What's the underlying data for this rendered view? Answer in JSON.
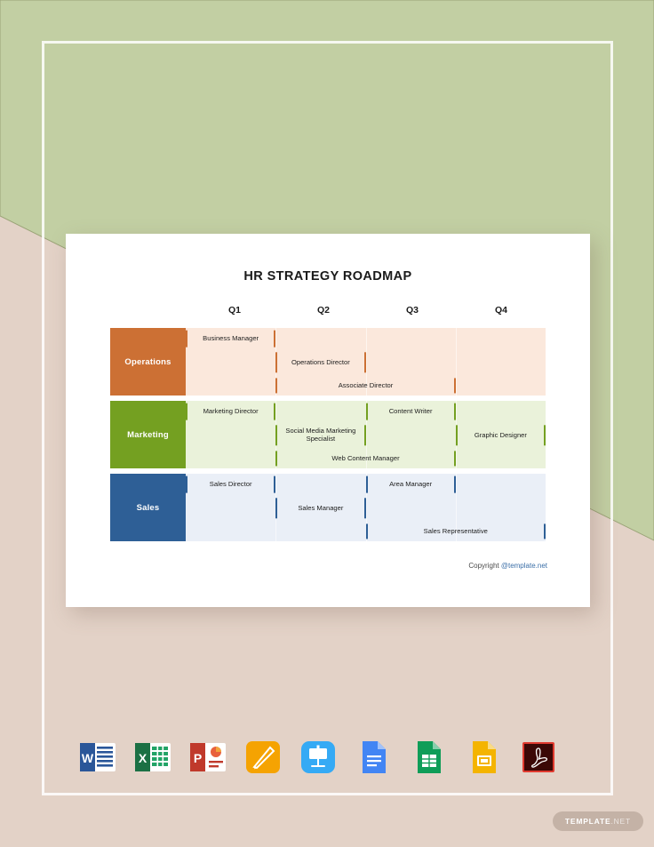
{
  "theme": {
    "background_beige": "#e3d2c7",
    "background_green": "#c2cfa3",
    "card_white": "#ffffff",
    "operations_color": "#cc7034",
    "marketing_color": "#74a021",
    "sales_color": "#2e5f96",
    "operations_tint": "#fbe8dc",
    "marketing_tint": "#eaf2da",
    "sales_tint": "#eaeff7",
    "link_blue": "#3b6fa8"
  },
  "document": {
    "title": "HR STRATEGY ROADMAP",
    "copyright_prefix": "Copyright ",
    "copyright_link": "@template.net"
  },
  "chart_data": {
    "type": "bar",
    "title": "HR STRATEGY ROADMAP",
    "xlabel": "",
    "ylabel": "",
    "categories": [
      "Q1",
      "Q2",
      "Q3",
      "Q4"
    ],
    "quarter_positions_pct": [
      12.5,
      37.5,
      62.5,
      87.5
    ],
    "series": [
      {
        "name": "Operations",
        "color": "#cc7034",
        "tint": "#fbe8dc",
        "tasks": [
          {
            "label": "Business Manager",
            "start_pct": 0,
            "end_pct": 25,
            "lane": 0
          },
          {
            "label": "Operations Director",
            "start_pct": 25,
            "end_pct": 50,
            "lane": 1
          },
          {
            "label": "Associate Director",
            "start_pct": 25,
            "end_pct": 75,
            "lane": 2
          }
        ]
      },
      {
        "name": "Marketing",
        "color": "#74a021",
        "tint": "#eaf2da",
        "tasks": [
          {
            "label": "Marketing Director",
            "start_pct": 0,
            "end_pct": 25,
            "lane": 0
          },
          {
            "label": "Content Writer",
            "start_pct": 50,
            "end_pct": 75,
            "lane": 0
          },
          {
            "label": "Graphic Designer",
            "start_pct": 75,
            "end_pct": 100,
            "lane": 1
          },
          {
            "label": "Social Media Marketing Specialist",
            "start_pct": 25,
            "end_pct": 50,
            "lane": 1
          },
          {
            "label": "Web Content Manager",
            "start_pct": 25,
            "end_pct": 75,
            "lane": 2
          }
        ]
      },
      {
        "name": "Sales",
        "color": "#2e5f96",
        "tint": "#eaeff7",
        "tasks": [
          {
            "label": "Sales Director",
            "start_pct": 0,
            "end_pct": 25,
            "lane": 0
          },
          {
            "label": "Area Manager",
            "start_pct": 50,
            "end_pct": 75,
            "lane": 0
          },
          {
            "label": "Sales Manager",
            "start_pct": 25,
            "end_pct": 50,
            "lane": 1
          },
          {
            "label": "Sales Representative",
            "start_pct": 50,
            "end_pct": 100,
            "lane": 2
          }
        ]
      }
    ]
  },
  "file_formats": [
    {
      "name": "word-icon",
      "label": "Word"
    },
    {
      "name": "excel-icon",
      "label": "Excel"
    },
    {
      "name": "powerpoint-icon",
      "label": "PowerPoint"
    },
    {
      "name": "pages-icon",
      "label": "Pages"
    },
    {
      "name": "keynote-icon",
      "label": "Keynote"
    },
    {
      "name": "google-docs-icon",
      "label": "Google Docs"
    },
    {
      "name": "google-sheets-icon",
      "label": "Google Sheets"
    },
    {
      "name": "google-slides-icon",
      "label": "Google Slides"
    },
    {
      "name": "pdf-icon",
      "label": "PDF"
    }
  ],
  "brand_badge": {
    "main": "TEMPLATE",
    "suffix": ".NET"
  }
}
